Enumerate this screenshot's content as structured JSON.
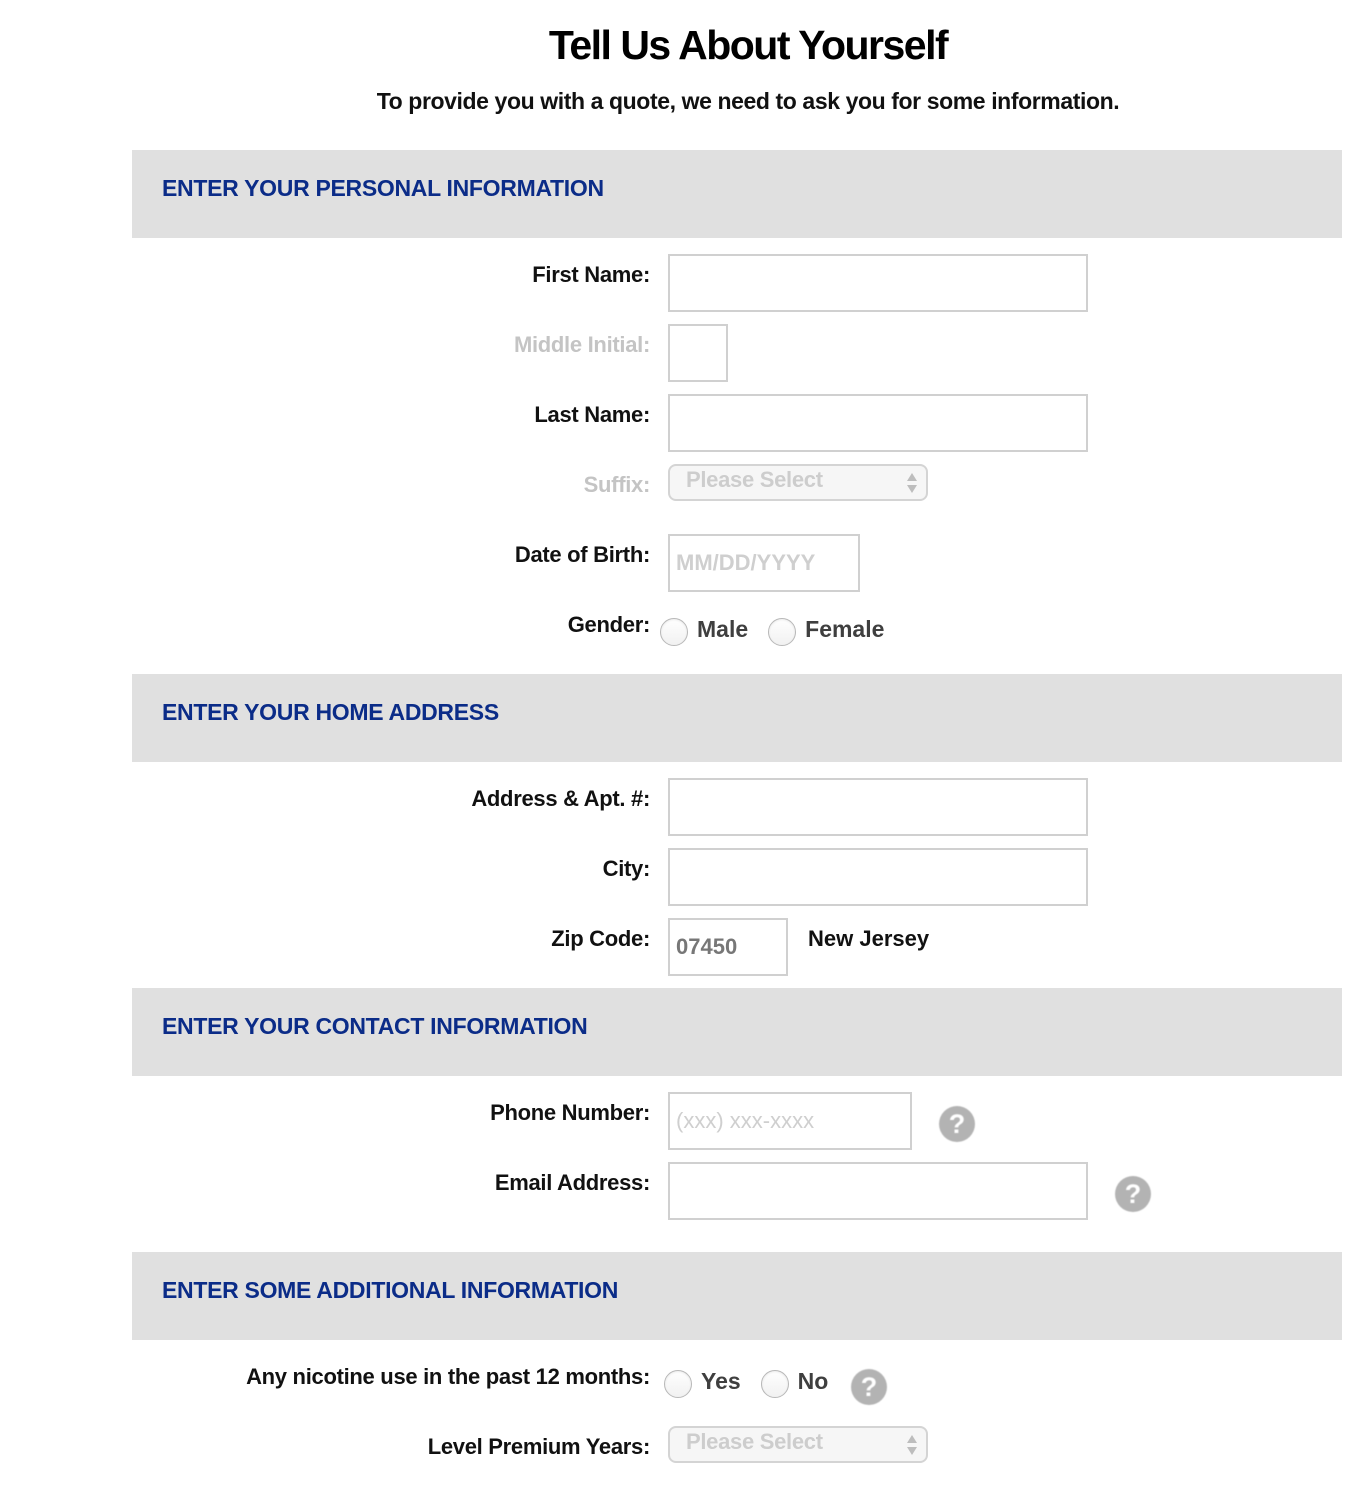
{
  "page": {
    "title": "Tell Us About Yourself",
    "subtitle": "To provide you with a quote, we need to ask you for some information."
  },
  "colors": {
    "section_header_bg": "#e0e0e0",
    "section_header_text": "#0b2c88",
    "input_border": "#d0d0d0",
    "muted_label": "#c4c4c4",
    "help_icon": "#b3b3b3"
  },
  "sections": {
    "personal": {
      "heading": "ENTER YOUR PERSONAL INFORMATION",
      "first_name": {
        "label": "First Name:",
        "value": "",
        "placeholder": ""
      },
      "middle_initial": {
        "label": "Middle Initial:",
        "value": "",
        "placeholder": ""
      },
      "last_name": {
        "label": "Last Name:",
        "value": "",
        "placeholder": ""
      },
      "suffix": {
        "label": "Suffix:",
        "selected": "Please Select"
      },
      "dob": {
        "label": "Date of Birth:",
        "value": "",
        "placeholder": "MM/DD/YYYY"
      },
      "gender": {
        "label": "Gender:",
        "options": [
          "Male",
          "Female"
        ],
        "selected": null
      }
    },
    "address": {
      "heading": "ENTER YOUR HOME ADDRESS",
      "address": {
        "label": "Address & Apt. #:",
        "value": "",
        "placeholder": ""
      },
      "city": {
        "label": "City:",
        "value": "",
        "placeholder": ""
      },
      "zip": {
        "label": "Zip Code:",
        "value": "07450"
      },
      "state": "New Jersey"
    },
    "contact": {
      "heading": "ENTER YOUR CONTACT INFORMATION",
      "phone": {
        "label": "Phone Number:",
        "value": "",
        "placeholder": "(xxx) xxx-xxxx",
        "help_icon": "question-circle"
      },
      "email": {
        "label": "Email Address:",
        "value": "",
        "placeholder": "",
        "help_icon": "question-circle"
      }
    },
    "additional": {
      "heading": "ENTER SOME ADDITIONAL INFORMATION",
      "nicotine": {
        "label": "Any nicotine use in the past 12 months:",
        "options": [
          "Yes",
          "No"
        ],
        "selected": null,
        "help_icon": "question-circle"
      },
      "level_premium": {
        "label": "Level Premium Years:",
        "selected": "Please Select"
      }
    }
  },
  "icons": {
    "help": "?"
  }
}
